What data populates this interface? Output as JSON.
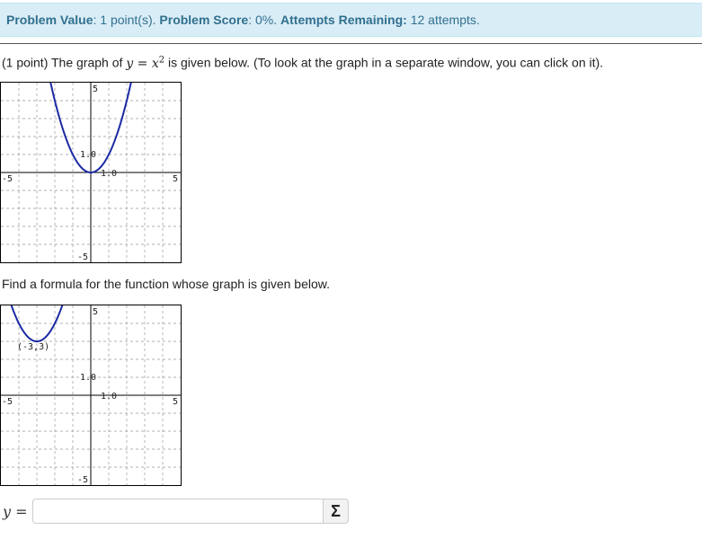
{
  "banner": {
    "value_label": "Problem Value",
    "value_text": ": 1 point(s). ",
    "score_label": "Problem Score",
    "score_text": ": 0%. ",
    "attempts_label": "Attempts Remaining:",
    "attempts_text": " 12 attempts."
  },
  "problem": {
    "prefix": "(1 point) The graph of ",
    "equation_y": "y",
    "equation_eq": " = ",
    "equation_x": "x",
    "equation_exp": "2",
    "suffix": " is given below. (To look at the graph in a separate window, you can click on it)."
  },
  "graph1": {
    "labels": {
      "top": "5",
      "bottom": "-5",
      "left": "-5",
      "right": "5",
      "y_unit": "1.0",
      "x_unit": "1.0"
    },
    "curve_color": "#1a2aa3"
  },
  "find_text": "Find a formula for the function whose graph is given below.",
  "graph2": {
    "labels": {
      "top": "5",
      "bottom": "-5",
      "left": "-5",
      "right": "5",
      "y_unit": "1.0",
      "x_unit": "1.0",
      "vertex": "(-3,3)"
    },
    "curve_color": "#1a2aa3"
  },
  "answer": {
    "label": "y =",
    "value": "",
    "sigma": "Σ"
  }
}
